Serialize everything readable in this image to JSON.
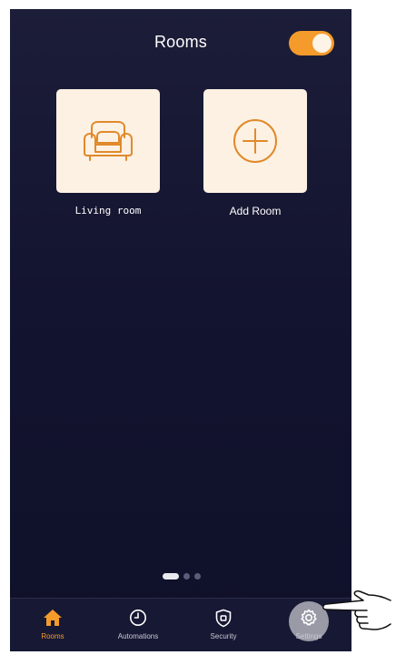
{
  "header": {
    "title": "Rooms",
    "toggle_on": true
  },
  "rooms": [
    {
      "label": "Living room",
      "icon": "armchair-icon"
    },
    {
      "label": "Add Room",
      "icon": "plus-circle-icon"
    }
  ],
  "pager": {
    "pages": 3,
    "active": 1
  },
  "tabs": [
    {
      "label": "Rooms",
      "icon": "home-icon",
      "active": true
    },
    {
      "label": "Automations",
      "icon": "clock-icon",
      "active": false
    },
    {
      "label": "Security",
      "icon": "shield-icon",
      "active": false
    },
    {
      "label": "Settings",
      "icon": "gear-icon",
      "active": false
    }
  ],
  "colors": {
    "accent": "#f59b2b",
    "background": "#131430",
    "tile": "#fdf1e4"
  }
}
